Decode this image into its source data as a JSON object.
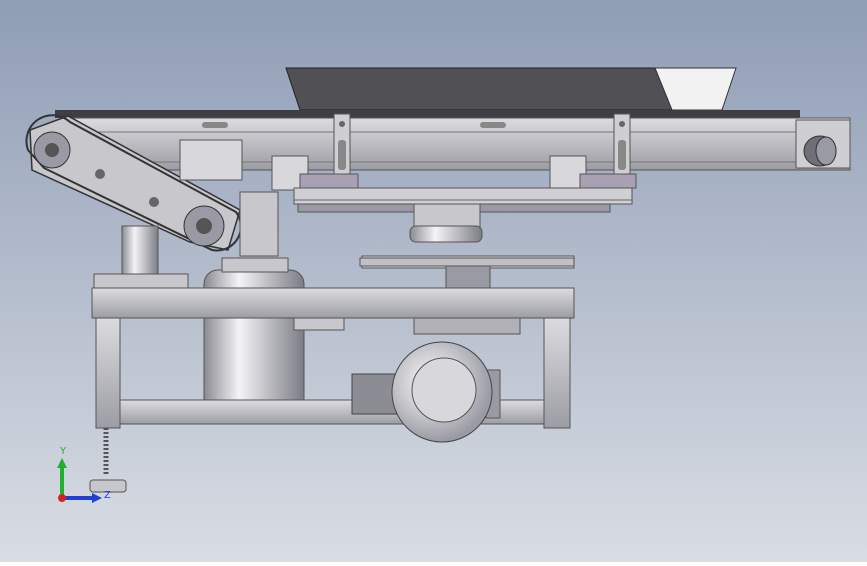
{
  "viewport": {
    "background_top": "#8f9db5",
    "background_bottom": "#d9dde4"
  },
  "colors": {
    "metal": "#b9b9bd",
    "metal_dark": "#6f6f78",
    "belt": "#3e3e44",
    "hopper": "#505055",
    "white_part": "#f2f2f2",
    "axis_x": "#d92020",
    "axis_y": "#20b030",
    "axis_z": "#2040d0"
  },
  "triad": {
    "y_label": "Y",
    "z_label": "Z"
  },
  "icons": {
    "triad": "coordinate-triad-icon"
  }
}
